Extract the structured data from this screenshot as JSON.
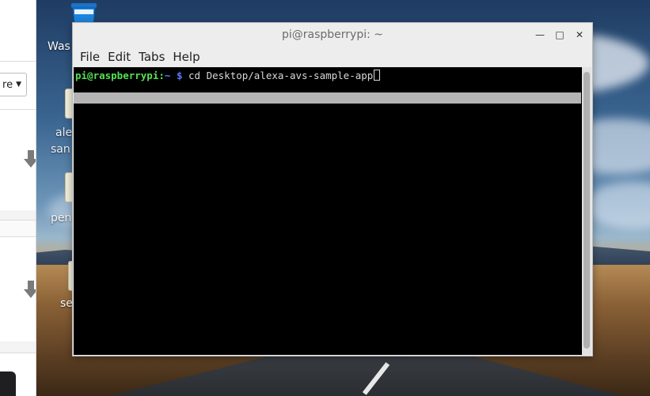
{
  "desktop": {
    "icons": [
      {
        "label": "Was"
      },
      {
        "label": "ale"
      },
      {
        "label": "san"
      },
      {
        "label": "pen"
      },
      {
        "label": "se"
      }
    ]
  },
  "browser": {
    "dropdown_text": "re"
  },
  "terminal": {
    "title": "pi@raspberrypi: ~",
    "controls": {
      "minimize": "—",
      "maximize": "□",
      "close": "✕"
    },
    "menu": [
      "File",
      "Edit",
      "Tabs",
      "Help"
    ],
    "prompt": {
      "user_host": "pi@raspberrypi",
      "separator": ":",
      "path": "~",
      "symbol": "$"
    },
    "command": " cd Desktop/alexa-avs-sample-app"
  },
  "colors": {
    "prompt_user": "#55e055",
    "prompt_path": "#5b7cff",
    "terminal_bg": "#000000",
    "window_chrome": "#ededed"
  }
}
